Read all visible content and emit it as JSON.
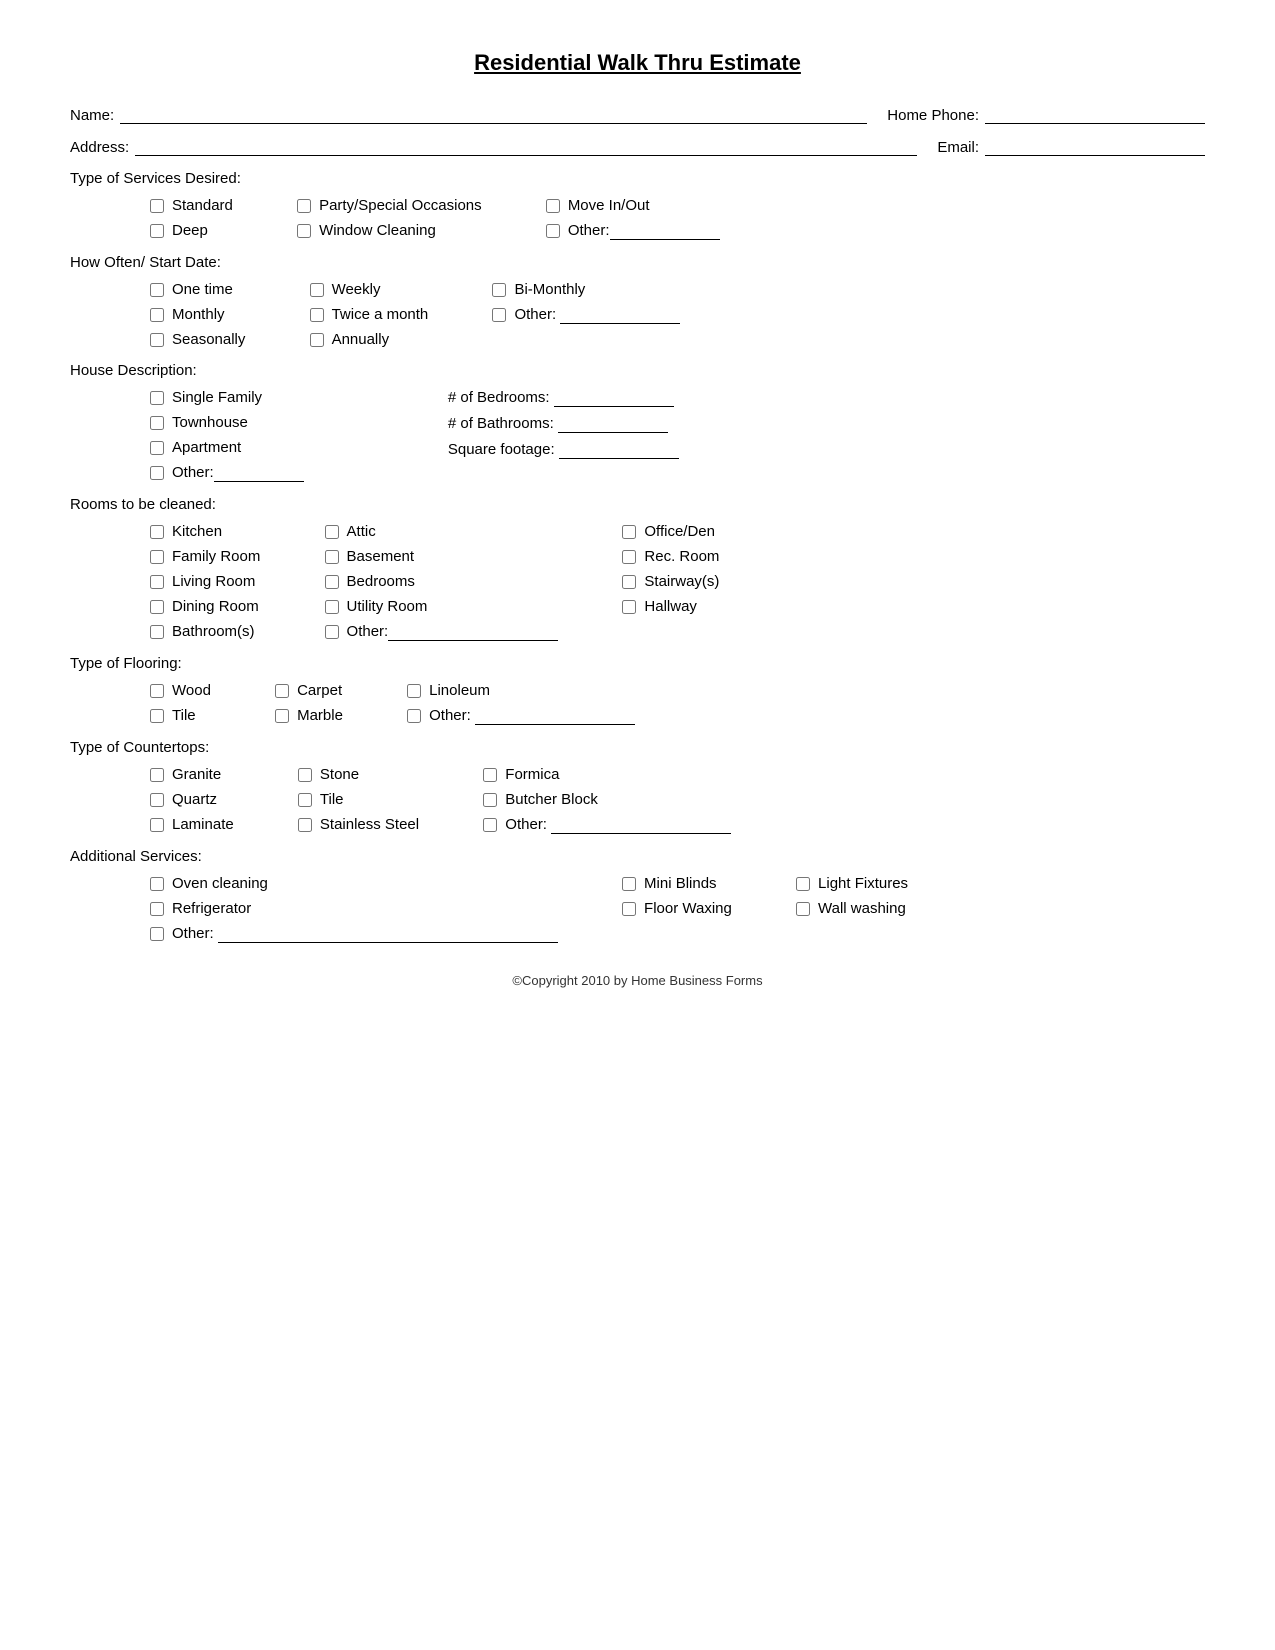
{
  "title": "Residential Walk Thru Estimate",
  "fields": {
    "name_label": "Name:",
    "home_phone_label": "Home Phone:",
    "address_label": "Address:",
    "email_label": "Email:"
  },
  "sections": {
    "services": {
      "label": "Type of Services Desired:",
      "col1": [
        "Standard",
        "Deep"
      ],
      "col2": [
        "Party/Special Occasions",
        "Window Cleaning"
      ],
      "col3_items": [
        "Move In/Out"
      ],
      "col3_other": "Other:"
    },
    "how_often": {
      "label": "How Often/ Start Date:",
      "col1": [
        "One time",
        "Monthly",
        "Seasonally"
      ],
      "col2": [
        "Weekly",
        "Twice a month",
        "Annually"
      ],
      "col3": [
        "Bi-Monthly"
      ],
      "col3_other": "Other:"
    },
    "house_desc": {
      "label": "House Description:",
      "col1": [
        "Single Family",
        "Townhouse",
        "Apartment"
      ],
      "col1_other": "Other:",
      "col2_bedrooms": "# of Bedrooms:",
      "col2_bathrooms": "# of Bathrooms:",
      "col2_sqft": "Square footage:"
    },
    "rooms": {
      "label": "Rooms to be cleaned:",
      "col1": [
        "Kitchen",
        "Family Room",
        "Living Room",
        "Dining Room",
        "Bathroom(s)"
      ],
      "col2": [
        "Attic",
        "Basement",
        "Bedrooms",
        "Utility Room"
      ],
      "col2_other": "Other:",
      "col3": [
        "Office/Den",
        "Rec. Room",
        "Stairway(s)",
        "Hallway"
      ]
    },
    "flooring": {
      "label": "Type of Flooring:",
      "col1": [
        "Wood",
        "Tile"
      ],
      "col2": [
        "Carpet",
        "Marble"
      ],
      "col3": [
        "Linoleum"
      ],
      "col3_other": "Other:"
    },
    "countertops": {
      "label": "Type of Countertops:",
      "col1": [
        "Granite",
        "Quartz",
        "Laminate"
      ],
      "col2": [
        "Stone",
        "Tile",
        "Stainless Steel"
      ],
      "col3": [
        "Formica",
        "Butcher Block"
      ],
      "col3_other": "Other:"
    },
    "additional": {
      "label": "Additional Services:",
      "col1": [
        "Oven cleaning",
        "Refrigerator"
      ],
      "col1_other": "Other:",
      "col2": [
        "Mini Blinds",
        "Floor Waxing"
      ],
      "col3": [
        "Light Fixtures",
        "Wall washing"
      ]
    }
  },
  "footer": "©Copyright 2010 by Home Business Forms"
}
